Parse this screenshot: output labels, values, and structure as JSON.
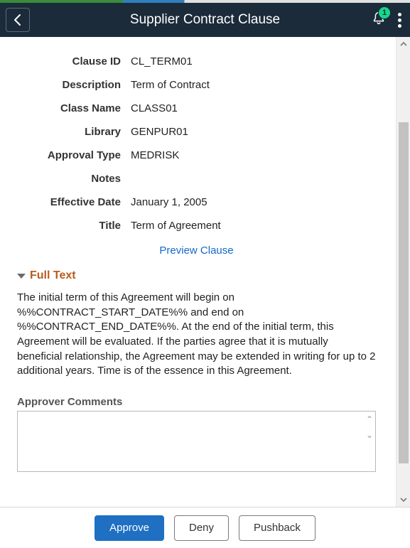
{
  "header": {
    "title": "Supplier Contract Clause",
    "notification_count": "1"
  },
  "fields": {
    "clause_id": {
      "label": "Clause ID",
      "value": "CL_TERM01"
    },
    "description": {
      "label": "Description",
      "value": "Term of Contract"
    },
    "class_name": {
      "label": "Class Name",
      "value": "CLASS01"
    },
    "library": {
      "label": "Library",
      "value": "GENPUR01"
    },
    "approval_type": {
      "label": "Approval Type",
      "value": "MEDRISK"
    },
    "notes": {
      "label": "Notes",
      "value": ""
    },
    "effective_date": {
      "label": "Effective Date",
      "value": "January 1, 2005"
    },
    "title": {
      "label": "Title",
      "value": "Term of Agreement"
    }
  },
  "preview_link": "Preview Clause",
  "full_text": {
    "heading": "Full Text",
    "body": "The initial term of this Agreement will begin on %%CONTRACT_START_DATE%% and end on %%CONTRACT_END_DATE%%. At the end of the initial term, this Agreement will be evaluated. If the parties agree that it is mutually beneficial relationship, the Agreement may be extended in writing for up to 2 additional years. Time is of the essence in this Agreement."
  },
  "comments": {
    "label": "Approver Comments",
    "value": ""
  },
  "footer": {
    "approve": "Approve",
    "deny": "Deny",
    "pushback": "Pushback"
  }
}
